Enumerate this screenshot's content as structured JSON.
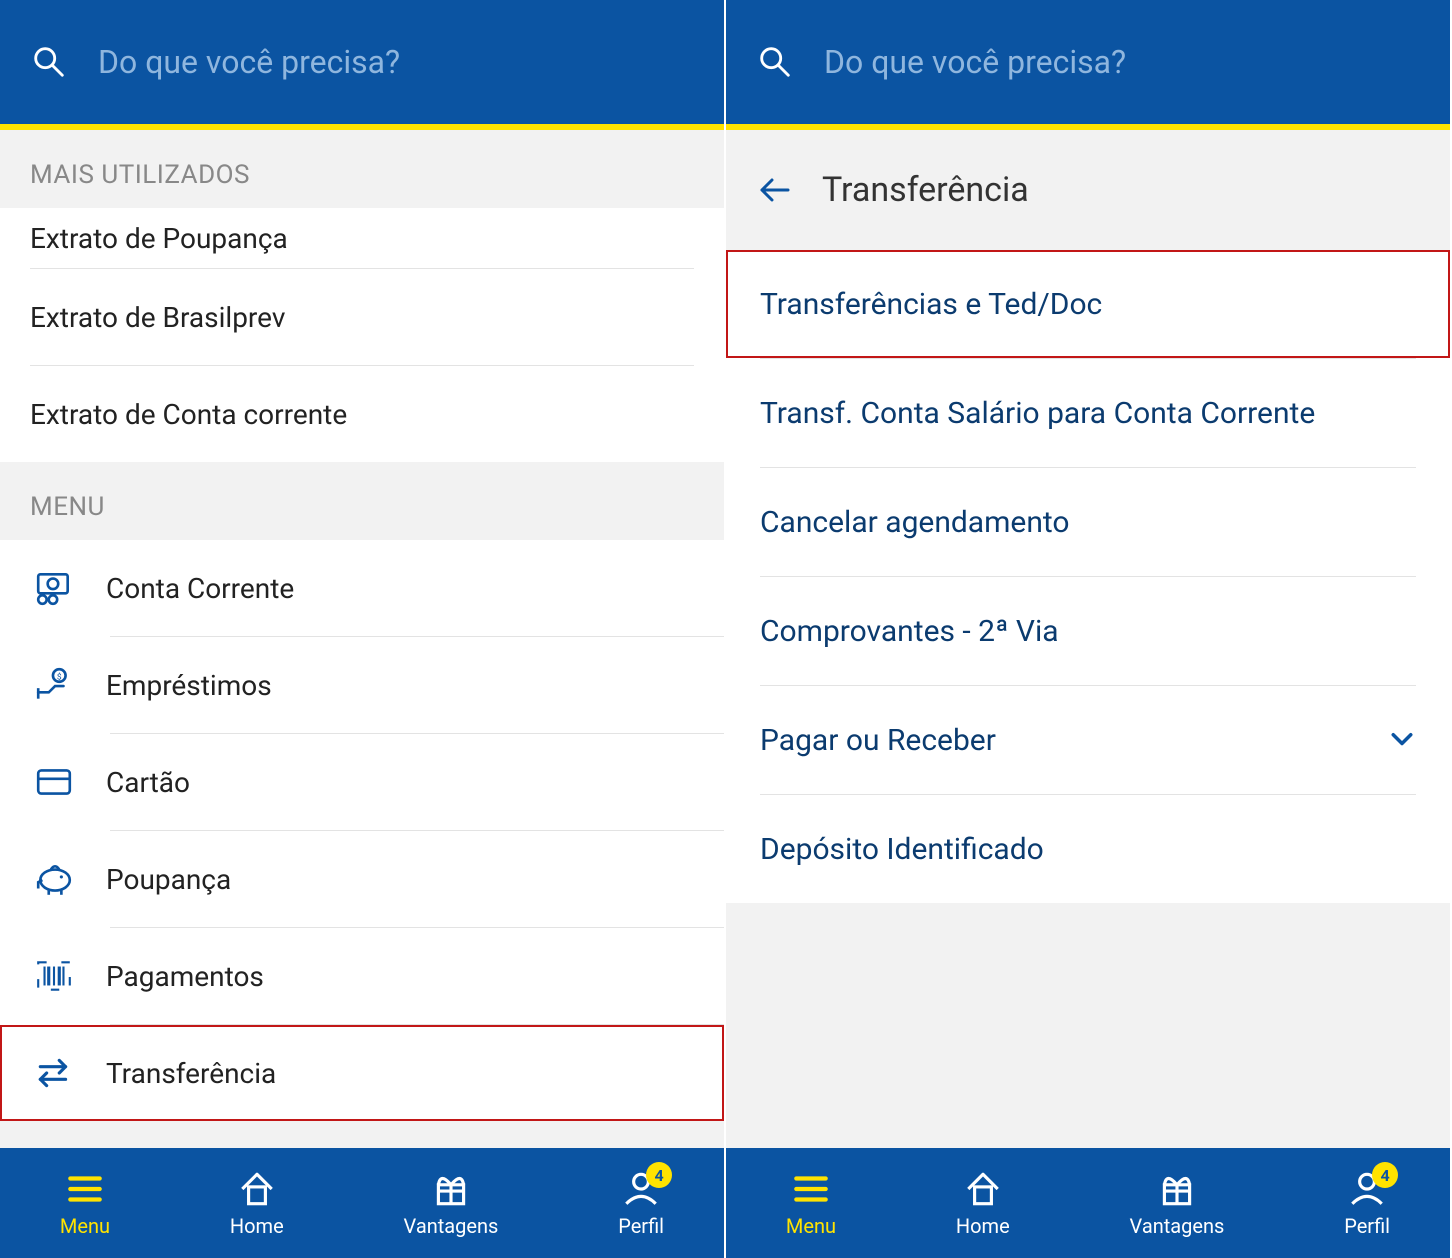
{
  "search_placeholder": "Do que você precisa?",
  "left": {
    "section_used_label": "MAIS UTILIZADOS",
    "used_items": [
      "Extrato de Poupança",
      "Extrato de Brasilprev",
      "Extrato de Conta corrente"
    ],
    "section_menu_label": "MENU",
    "menu_items": [
      {
        "label": "Conta Corrente",
        "icon": "money-icon"
      },
      {
        "label": "Empréstimos",
        "icon": "loan-icon"
      },
      {
        "label": "Cartão",
        "icon": "card-icon"
      },
      {
        "label": "Poupança",
        "icon": "piggy-icon"
      },
      {
        "label": "Pagamentos",
        "icon": "barcode-icon"
      },
      {
        "label": "Transferência",
        "icon": "transfer-icon"
      }
    ],
    "menu_highlight_index": 5
  },
  "right": {
    "page_title": "Transferência",
    "items": [
      {
        "label": "Transferências e Ted/Doc",
        "expandable": false
      },
      {
        "label": "Transf. Conta Salário para Conta Corrente",
        "expandable": false
      },
      {
        "label": "Cancelar agendamento",
        "expandable": false
      },
      {
        "label": "Comprovantes - 2ª Via",
        "expandable": false
      },
      {
        "label": "Pagar ou Receber",
        "expandable": true
      },
      {
        "label": "Depósito Identificado",
        "expandable": false
      }
    ],
    "highlight_index": 0
  },
  "nav": {
    "items": [
      {
        "label": "Menu",
        "icon": "menu-icon",
        "active": true
      },
      {
        "label": "Home",
        "icon": "home-icon",
        "active": false
      },
      {
        "label": "Vantagens",
        "icon": "gift-icon",
        "active": false
      },
      {
        "label": "Perfil",
        "icon": "profile-icon",
        "active": false,
        "badge": "4"
      }
    ]
  }
}
